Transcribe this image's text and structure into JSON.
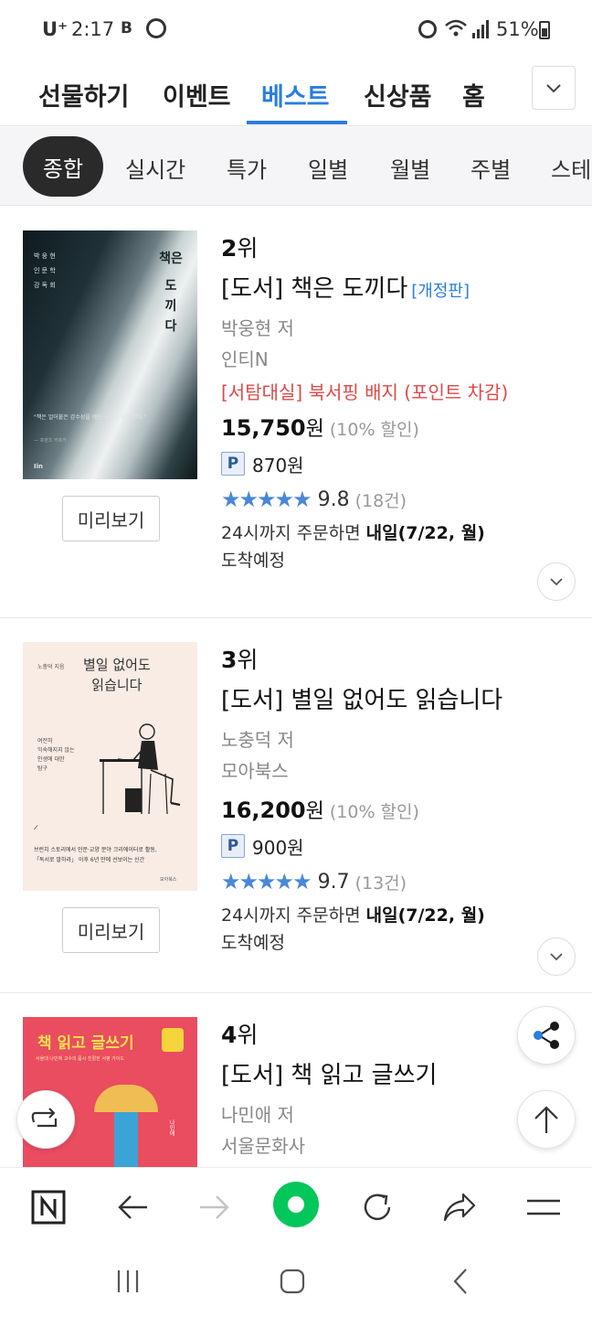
{
  "status_bar": {
    "carrier": "U⁺",
    "time": "2:17",
    "battery_percent": "51%",
    "b_icon_text": "B"
  },
  "category_tabs": [
    {
      "label": "선물하기"
    },
    {
      "label": "이벤트"
    },
    {
      "label": "베스트"
    },
    {
      "label": "신상품"
    },
    {
      "label": "홈"
    }
  ],
  "sub_tabs": [
    {
      "label": "종합"
    },
    {
      "label": "실시간"
    },
    {
      "label": "특가"
    },
    {
      "label": "일별"
    },
    {
      "label": "월별"
    },
    {
      "label": "주별"
    },
    {
      "label": "스테"
    }
  ],
  "books": [
    {
      "rank_num": "2",
      "rank_suffix": "위",
      "title": "[도서] 책은 도끼다",
      "edition": "[개정판]",
      "author": "박웅현 저",
      "publisher": "인티N",
      "badge": "[서탐대실] 북서핑 배지 (포인트 차감)",
      "price": "15,750",
      "won": "원",
      "discount": "(10% 할인)",
      "point_label": "P",
      "points": "870원",
      "stars": "★★★★★",
      "score": "9.8",
      "reviews": "(18건)",
      "delivery_prefix": "24시까지 주문하면",
      "delivery_date": "내일(7/22, 월)",
      "delivery_suffix": "도착예정",
      "preview": "미리보기",
      "cover": {
        "title_chars": [
          "책은",
          "도",
          "끼",
          "다"
        ],
        "authors": [
          "박 웅 현",
          "인 문 학",
          "강 독 회"
        ],
        "quote": "\"책은 얼어붙은 감수성을 깨는 도끼가 돼야 한다.\"",
        "quote_src": "— 프란츠 카프카",
        "logo": "Iin"
      }
    },
    {
      "rank_num": "3",
      "rank_suffix": "위",
      "title": "[도서] 별일 없어도 읽습니다",
      "author": "노충덕 저",
      "publisher": "모아북스",
      "price": "16,200",
      "won": "원",
      "discount": "(10% 할인)",
      "point_label": "P",
      "points": "900원",
      "stars": "★★★★★",
      "score": "9.7",
      "reviews": "(13건)",
      "delivery_prefix": "24시까지 주문하면",
      "delivery_date": "내일(7/22, 월)",
      "delivery_suffix": "도착예정",
      "preview": "미리보기",
      "cover": {
        "author_small": "노충덕 지음",
        "title_line1": "별일 없어도",
        "title_line2": "읽습니다",
        "sub1": "여전히",
        "sub2": "익숙해지지 않는",
        "sub3": "인생에 대한",
        "sub4": "탐구",
        "blurb1": "브런치 스토리에서 인문·교양 분야 크리에이터로 활동,",
        "blurb2": "「독서로 말하라」 이후 6년 만에 선보이는 신간",
        "publisher_small": "모아북스"
      }
    },
    {
      "rank_num": "4",
      "rank_suffix": "위",
      "title": "[도서] 책 읽고 글쓰기",
      "author": "나민애 저",
      "publisher": "서울문화사",
      "cover": {
        "title": "책 읽고 글쓰기",
        "subtitle": "서울대 나민애 교수의 몹시 친절한 서평 가이드",
        "author_small": "나민애"
      }
    }
  ],
  "colors": {
    "accent": "#2a7de1",
    "badge_red": "#e04848",
    "star_blue": "#4a87d8",
    "naver_green": "#03c75a",
    "dark_pill": "#2a2a2a"
  },
  "icons": {
    "cat_more": "chevron-down-icon",
    "expand": "chevron-down-icon",
    "share": "share-icon",
    "scroll_top": "arrow-up-icon",
    "refresh_float": "swap-icon",
    "browser": [
      "naver-n-icon",
      "back-arrow-icon",
      "forward-arrow-icon",
      "green-circle-icon",
      "reload-icon",
      "share-arrow-icon",
      "menu-icon"
    ],
    "nav": [
      "recent-apps-icon",
      "home-icon",
      "back-icon"
    ]
  }
}
